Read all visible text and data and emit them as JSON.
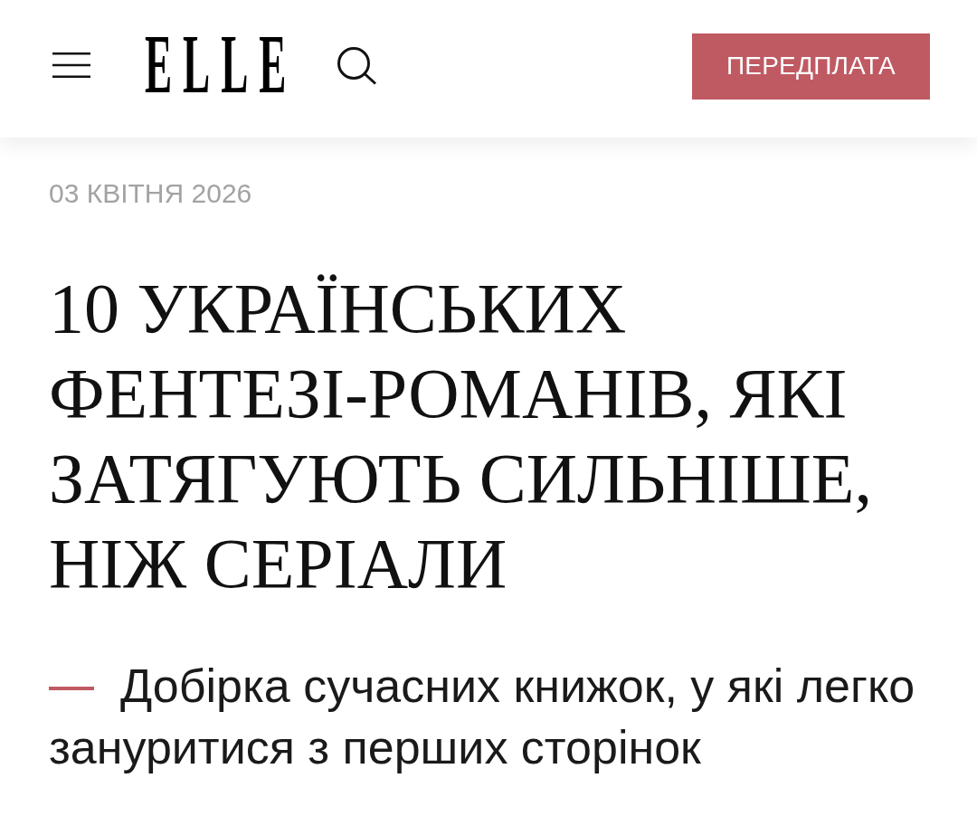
{
  "header": {
    "logo": "ELLE",
    "subscribe_button": "ПЕРЕДПЛАТА"
  },
  "article": {
    "date": "03 КВІТНЯ 2026",
    "title": "10 УКРАЇНСЬКИХ ФЕНТЕЗІ-РОМАНІВ, ЯКІ ЗАТЯГУЮТЬ СИЛЬНІШЕ, НІЖ СЕРІАЛИ",
    "lead": "Добірка сучасних книжок, у які легко зануритися з перших сторінок"
  }
}
